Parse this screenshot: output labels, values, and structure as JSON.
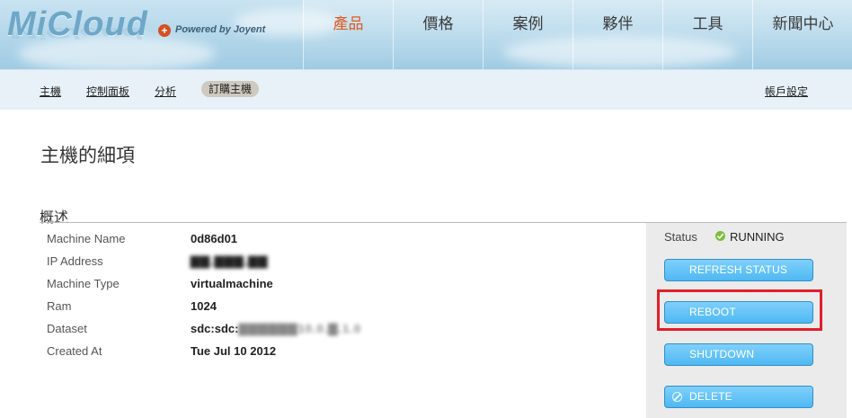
{
  "header": {
    "logo_text": "MiCloud",
    "powered_by": "Powered by Joyent",
    "nav": [
      "產品",
      "價格",
      "案例",
      "夥伴",
      "工具",
      "新聞中心"
    ],
    "active_nav": 0
  },
  "subnav": {
    "items": [
      "主機",
      "控制面板",
      "分析"
    ],
    "active_item": "訂購主機",
    "account": "帳戶設定"
  },
  "page": {
    "title": "主機的細項",
    "section": "概述"
  },
  "details": [
    {
      "label": "Machine Name",
      "value": "0d86d01"
    },
    {
      "label": "IP Address",
      "value": "▇▇.▇▇▇.▇▇"
    },
    {
      "label": "Machine Type",
      "value": "virtualmachine"
    },
    {
      "label": "Ram",
      "value": "1024"
    },
    {
      "label": "Dataset",
      "value_prefix": "sdc:sdc:",
      "value_blurred": "▇▇▇▇▇▇10.0.▇.1.0"
    },
    {
      "label": "Created At",
      "value": "Tue Jul 10 2012"
    }
  ],
  "actions": {
    "status_label": "Status",
    "status_value": "RUNNING",
    "refresh": "REFRESH STATUS",
    "reboot": "REBOOT",
    "shutdown": "SHUTDOWN",
    "delete": "DELETE"
  },
  "colors": {
    "active_nav": "#e05a1e",
    "button": "#4fb8f3",
    "highlight": "#e0202a",
    "status_ok": "#7cbf3b"
  }
}
